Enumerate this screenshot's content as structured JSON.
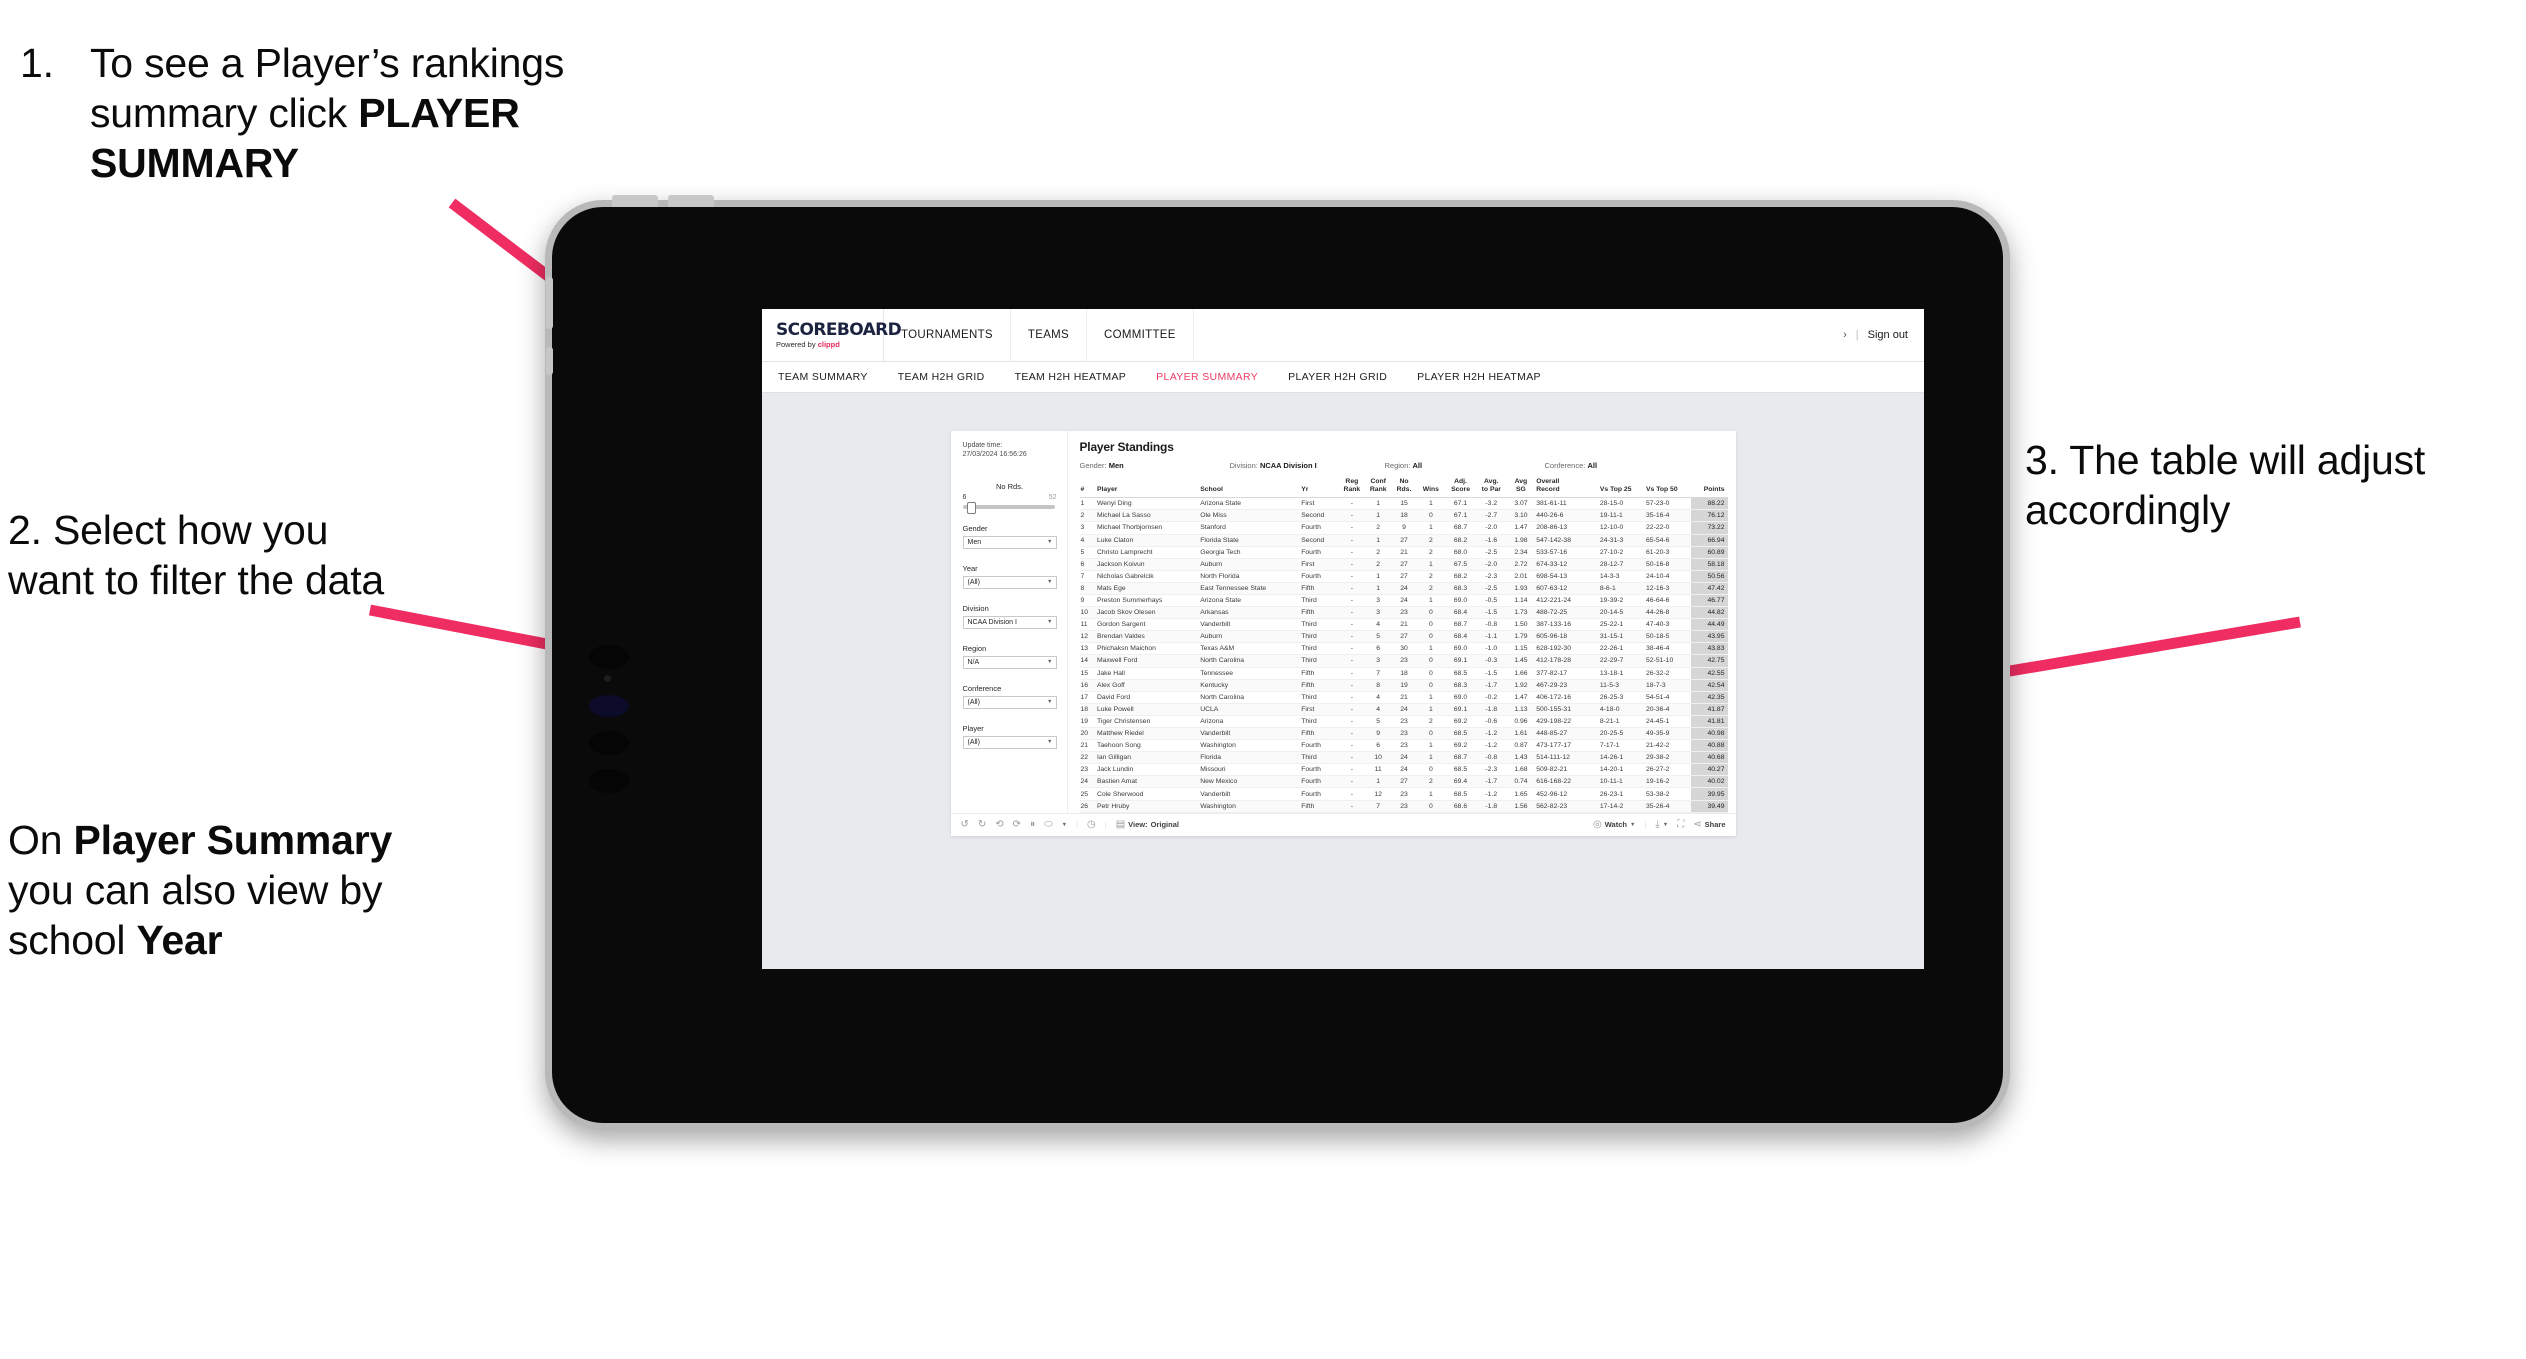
{
  "annotations": {
    "step1": {
      "number": "1.",
      "text_a": "To see a Player’s rankings",
      "text_b": "summary click ",
      "bold_b": "PLAYER",
      "bold_c": "SUMMARY"
    },
    "step2": {
      "text": "2. Select how you want to filter the data"
    },
    "step2b": {
      "pre": "On ",
      "bold1": "Player Summary",
      "mid": " you can also view by school ",
      "bold2": "Year"
    },
    "step3": {
      "text": "3. The table will adjust accordingly"
    },
    "arrow_color": "#ef2d62"
  },
  "app": {
    "logo": {
      "word": "SCOREBOARD",
      "powered_by": "Powered by ",
      "brand": "clippd"
    },
    "top_nav": [
      "TOURNAMENTS",
      "TEAMS",
      "COMMITTEE"
    ],
    "header_right": {
      "user": "›",
      "separator": "|",
      "sign_out": "Sign out"
    },
    "sub_nav": [
      {
        "label": "TEAM SUMMARY",
        "active": false
      },
      {
        "label": "TEAM H2H GRID",
        "active": false
      },
      {
        "label": "TEAM H2H HEATMAP",
        "active": false
      },
      {
        "label": "PLAYER SUMMARY",
        "active": true
      },
      {
        "label": "PLAYER H2H GRID",
        "active": false
      },
      {
        "label": "PLAYER H2H HEATMAP",
        "active": false
      }
    ],
    "active_tab_color": "#ef3b68"
  },
  "viz": {
    "update_time_label": "Update time:",
    "update_time_value": "27/03/2024 16:56:26",
    "title": "Player Standings",
    "meta": [
      {
        "label": "Gender:",
        "value": "Men"
      },
      {
        "label": "Division:",
        "value": "NCAA Division I"
      },
      {
        "label": "Region:",
        "value": "All"
      },
      {
        "label": "Conference:",
        "value": "All"
      }
    ],
    "filters": {
      "slider": {
        "label": "No Rds.",
        "min": "6",
        "max": "52"
      },
      "selects": [
        {
          "label": "Gender",
          "value": "Men"
        },
        {
          "label": "Year",
          "value": "(All)"
        },
        {
          "label": "Division",
          "value": "NCAA Division I"
        },
        {
          "label": "Region",
          "value": "N/A"
        },
        {
          "label": "Conference",
          "value": "(All)"
        },
        {
          "label": "Player",
          "value": "(All)"
        }
      ]
    },
    "footer": {
      "undo": "undo-icon",
      "redo": "redo-icon",
      "revert": "revert-icon",
      "refresh": "refresh-icon",
      "pause": "pause-icon",
      "swap": "swap-icon",
      "history": "history-icon",
      "view_label": "View:",
      "view_value": "Original",
      "watch": "Watch",
      "download": "download-icon",
      "fullscreen": "fullscreen-icon",
      "share": "Share"
    },
    "table": {
      "columns": [
        {
          "key": "rank",
          "head": "#"
        },
        {
          "key": "player",
          "head": "Player"
        },
        {
          "key": "school",
          "head": "School"
        },
        {
          "key": "yr",
          "head": "Yr"
        },
        {
          "key": "reg",
          "head": "Reg\nRank"
        },
        {
          "key": "conf",
          "head": "Conf\nRank"
        },
        {
          "key": "nords",
          "head": "No\nRds."
        },
        {
          "key": "wins",
          "head": "Wins"
        },
        {
          "key": "adj",
          "head": "Adj.\nScore"
        },
        {
          "key": "par",
          "head": "Avg.\nto Par"
        },
        {
          "key": "sg",
          "head": "Avg\nSG"
        },
        {
          "key": "rec",
          "head": "Overall\nRecord"
        },
        {
          "key": "t25",
          "head": "Vs Top 25"
        },
        {
          "key": "t50",
          "head": "Vs Top 50"
        },
        {
          "key": "pts",
          "head": "Points"
        }
      ],
      "rows": [
        [
          "1",
          "Wenyi Ding",
          "Arizona State",
          "First",
          "-",
          "1",
          "15",
          "1",
          "67.1",
          "-3.2",
          "3.07",
          "381-61-11",
          "28-15-0",
          "57-23-0",
          "88.22"
        ],
        [
          "2",
          "Michael La Sasso",
          "Ole Miss",
          "Second",
          "-",
          "1",
          "18",
          "0",
          "67.1",
          "-2.7",
          "3.10",
          "440-26-6",
          "19-11-1",
          "35-16-4",
          "76.12"
        ],
        [
          "3",
          "Michael Thorbjornsen",
          "Stanford",
          "Fourth",
          "-",
          "2",
          "9",
          "1",
          "68.7",
          "-2.0",
          "1.47",
          "208-86-13",
          "12-10-0",
          "22-22-0",
          "73.22"
        ],
        [
          "4",
          "Luke Claton",
          "Florida State",
          "Second",
          "-",
          "1",
          "27",
          "2",
          "68.2",
          "-1.6",
          "1.98",
          "547-142-38",
          "24-31-3",
          "65-54-6",
          "66.94"
        ],
        [
          "5",
          "Christo Lamprecht",
          "Georgia Tech",
          "Fourth",
          "-",
          "2",
          "21",
          "2",
          "68.0",
          "-2.5",
          "2.34",
          "533-57-16",
          "27-10-2",
          "61-20-3",
          "60.89"
        ],
        [
          "6",
          "Jackson Koivun",
          "Auburn",
          "First",
          "-",
          "2",
          "27",
          "1",
          "67.5",
          "-2.0",
          "2.72",
          "674-33-12",
          "28-12-7",
          "50-16-8",
          "58.18"
        ],
        [
          "7",
          "Nicholas Gabrelcik",
          "North Florida",
          "Fourth",
          "-",
          "1",
          "27",
          "2",
          "68.2",
          "-2.3",
          "2.01",
          "698-54-13",
          "14-3-3",
          "24-10-4",
          "50.56"
        ],
        [
          "8",
          "Mats Ege",
          "East Tennessee State",
          "Fifth",
          "-",
          "1",
          "24",
          "2",
          "68.3",
          "-2.5",
          "1.93",
          "607-63-12",
          "8-6-1",
          "12-16-3",
          "47.42"
        ],
        [
          "9",
          "Preston Summerhays",
          "Arizona State",
          "Third",
          "-",
          "3",
          "24",
          "1",
          "69.0",
          "-0.5",
          "1.14",
          "412-221-24",
          "19-39-2",
          "46-64-6",
          "46.77"
        ],
        [
          "10",
          "Jacob Skov Olesen",
          "Arkansas",
          "Fifth",
          "-",
          "3",
          "23",
          "0",
          "68.4",
          "-1.5",
          "1.73",
          "488-72-25",
          "20-14-5",
          "44-26-8",
          "44.82"
        ],
        [
          "11",
          "Gordon Sargent",
          "Vanderbilt",
          "Third",
          "-",
          "4",
          "21",
          "0",
          "68.7",
          "-0.8",
          "1.50",
          "387-133-16",
          "25-22-1",
          "47-40-3",
          "44.49"
        ],
        [
          "12",
          "Brendan Valdes",
          "Auburn",
          "Third",
          "-",
          "5",
          "27",
          "0",
          "68.4",
          "-1.1",
          "1.79",
          "605-96-18",
          "31-15-1",
          "50-18-5",
          "43.95"
        ],
        [
          "13",
          "Phichaksn Maichon",
          "Texas A&M",
          "Third",
          "-",
          "6",
          "30",
          "1",
          "69.0",
          "-1.0",
          "1.15",
          "628-192-30",
          "22-26-1",
          "38-46-4",
          "43.83"
        ],
        [
          "14",
          "Maxwell Ford",
          "North Carolina",
          "Third",
          "-",
          "3",
          "23",
          "0",
          "69.1",
          "-0.3",
          "1.45",
          "412-178-28",
          "22-29-7",
          "52-51-10",
          "42.75"
        ],
        [
          "15",
          "Jake Hall",
          "Tennessee",
          "Fifth",
          "-",
          "7",
          "18",
          "0",
          "68.5",
          "-1.5",
          "1.66",
          "377-82-17",
          "13-18-1",
          "26-32-2",
          "42.55"
        ],
        [
          "16",
          "Alex Goff",
          "Kentucky",
          "Fifth",
          "-",
          "8",
          "19",
          "0",
          "68.3",
          "-1.7",
          "1.92",
          "467-29-23",
          "11-5-3",
          "18-7-3",
          "42.54"
        ],
        [
          "17",
          "David Ford",
          "North Carolina",
          "Third",
          "-",
          "4",
          "21",
          "1",
          "69.0",
          "-0.2",
          "1.47",
          "406-172-16",
          "26-25-3",
          "54-51-4",
          "42.35"
        ],
        [
          "18",
          "Luke Powell",
          "UCLA",
          "First",
          "-",
          "4",
          "24",
          "1",
          "69.1",
          "-1.8",
          "1.13",
          "500-155-31",
          "4-18-0",
          "20-36-4",
          "41.87"
        ],
        [
          "19",
          "Tiger Christensen",
          "Arizona",
          "Third",
          "-",
          "5",
          "23",
          "2",
          "69.2",
          "-0.6",
          "0.96",
          "429-198-22",
          "8-21-1",
          "24-45-1",
          "41.81"
        ],
        [
          "20",
          "Matthew Riedel",
          "Vanderbilt",
          "Fifth",
          "-",
          "9",
          "23",
          "0",
          "68.5",
          "-1.2",
          "1.61",
          "448-85-27",
          "20-25-5",
          "49-35-9",
          "40.98"
        ],
        [
          "21",
          "Taehoon Song",
          "Washington",
          "Fourth",
          "-",
          "6",
          "23",
          "1",
          "69.2",
          "-1.2",
          "0.87",
          "473-177-17",
          "7-17-1",
          "21-42-2",
          "40.88"
        ],
        [
          "22",
          "Ian Gilligan",
          "Florida",
          "Third",
          "-",
          "10",
          "24",
          "1",
          "68.7",
          "-0.8",
          "1.43",
          "514-111-12",
          "14-26-1",
          "29-38-2",
          "40.68"
        ],
        [
          "23",
          "Jack Lundin",
          "Missouri",
          "Fourth",
          "-",
          "11",
          "24",
          "0",
          "68.5",
          "-2.3",
          "1.68",
          "509-82-21",
          "14-20-1",
          "26-27-2",
          "40.27"
        ],
        [
          "24",
          "Bastien Amat",
          "New Mexico",
          "Fourth",
          "-",
          "1",
          "27",
          "2",
          "69.4",
          "-1.7",
          "0.74",
          "616-168-22",
          "10-11-1",
          "19-16-2",
          "40.02"
        ],
        [
          "25",
          "Cole Sherwood",
          "Vanderbilt",
          "Fourth",
          "-",
          "12",
          "23",
          "1",
          "68.5",
          "-1.2",
          "1.65",
          "452-96-12",
          "26-23-1",
          "53-38-2",
          "39.95"
        ],
        [
          "26",
          "Petr Hruby",
          "Washington",
          "Fifth",
          "-",
          "7",
          "23",
          "0",
          "68.6",
          "-1.8",
          "1.56",
          "562-82-23",
          "17-14-2",
          "35-26-4",
          "39.49"
        ]
      ]
    }
  }
}
